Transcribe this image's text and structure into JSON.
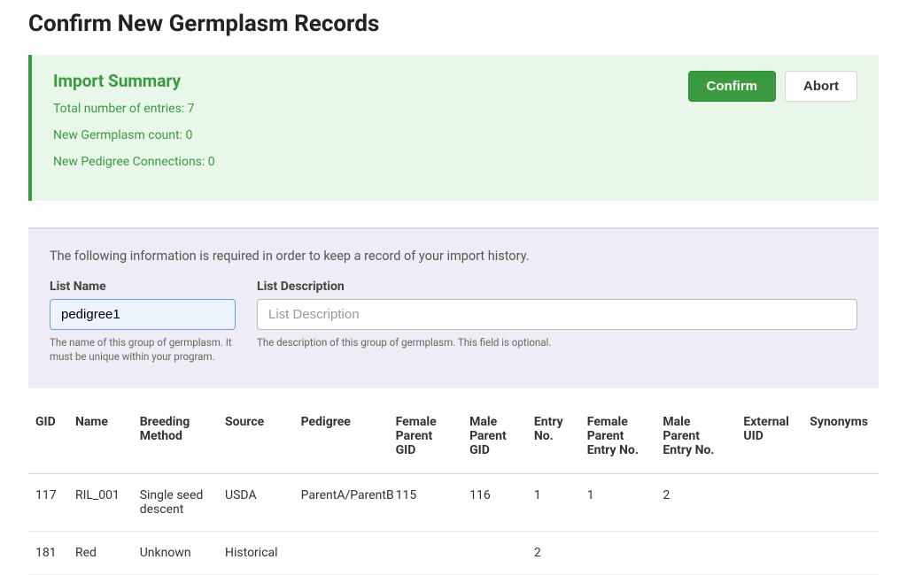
{
  "page_title": "Confirm New Germplasm Records",
  "summary": {
    "title": "Import Summary",
    "total_entries": "Total number of entries: 7",
    "new_germplasm": "New Germplasm count: 0",
    "new_pedigree": "New Pedigree Connections: 0",
    "confirm_label": "Confirm",
    "abort_label": "Abort"
  },
  "form": {
    "intro": "The following information is required in order to keep a record of your import history.",
    "list_name_label": "List Name",
    "list_name_value": "pedigree1",
    "list_name_help": "The name of this group of germplasm. It must be unique within your program.",
    "list_desc_label": "List Description",
    "list_desc_placeholder": "List Description",
    "list_desc_help": "The description of this group of germplasm. This field is optional."
  },
  "table": {
    "headers": {
      "gid": "GID",
      "name": "Name",
      "breeding_method": "Breeding Method",
      "source": "Source",
      "pedigree": "Pedigree",
      "female_parent_gid": "Female Parent GID",
      "male_parent_gid": "Male Parent GID",
      "entry_no": "Entry No.",
      "female_parent_entry_no": "Female Parent Entry No.",
      "male_parent_entry_no": "Male Parent Entry No.",
      "external_uid": "External UID",
      "synonyms": "Synonyms"
    },
    "rows": [
      {
        "gid": "117",
        "name": "RIL_001",
        "breeding_method": "Single seed descent",
        "source": "USDA",
        "pedigree": "ParentA/ParentB",
        "female_parent_gid": "115",
        "male_parent_gid": "116",
        "entry_no": "1",
        "female_parent_entry_no": "1",
        "male_parent_entry_no": "2",
        "external_uid": "",
        "synonyms": ""
      },
      {
        "gid": "181",
        "name": "Red",
        "breeding_method": "Unknown",
        "source": "Historical",
        "pedigree": "",
        "female_parent_gid": "",
        "male_parent_gid": "",
        "entry_no": "2",
        "female_parent_entry_no": "",
        "male_parent_entry_no": "",
        "external_uid": "",
        "synonyms": ""
      }
    ]
  }
}
